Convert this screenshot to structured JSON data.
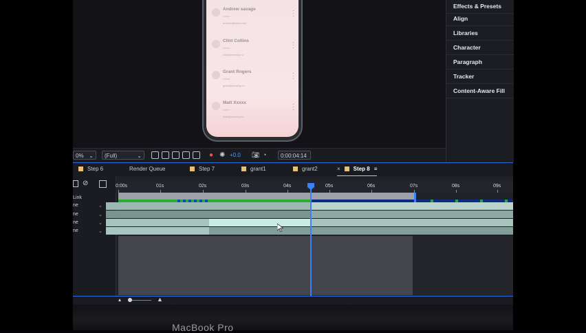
{
  "phone_contacts": [
    {
      "name": "Andrew savage",
      "role": "Driver",
      "email": "andrew@work.com"
    },
    {
      "name": "Clint Collins",
      "role": "Driver",
      "email": "clint@develop.ru"
    },
    {
      "name": "Grant Rogers",
      "role": "Driver",
      "email": "grant@develop.ru"
    },
    {
      "name": "Matt Xxxxx",
      "role": "Driver",
      "email": "matt@develop.ru"
    }
  ],
  "viewer_toolbar": {
    "zoom": "0%",
    "resolution": "(Full)",
    "exposure": "+0.0",
    "timecode": "0:00:04:14"
  },
  "side_panel": {
    "items": [
      "Effects & Presets",
      "Align",
      "Libraries",
      "Character",
      "Paragraph",
      "Tracker",
      "Content-Aware Fill"
    ]
  },
  "tabs": [
    {
      "label": "Step 6"
    },
    {
      "label": "Render Queue"
    },
    {
      "label": "Step 7"
    },
    {
      "label": "grant1"
    },
    {
      "label": "grant2"
    },
    {
      "label": "Step 8",
      "active": true
    }
  ],
  "timeline": {
    "ticks": [
      "0:00s",
      "01s",
      "02s",
      "03s",
      "04s",
      "05s",
      "06s",
      "07s",
      "08s",
      "09s"
    ],
    "link_label": "Link",
    "layer_labels": [
      "ne",
      "ne",
      "ne",
      "ne"
    ]
  },
  "colors": {
    "accent": "#3b82f6",
    "tab_swatch": "#e8c07a",
    "cache_green": "#23b02d"
  },
  "device_label": "MacBook Pro"
}
